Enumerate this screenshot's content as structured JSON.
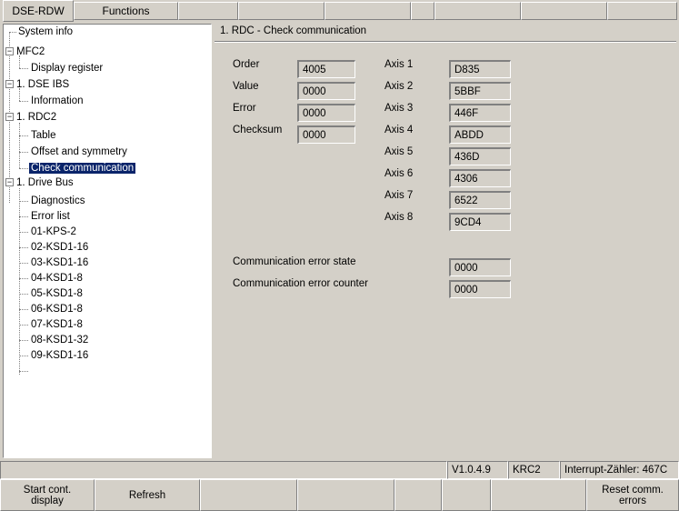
{
  "tabs": [
    {
      "label": "DSE-RDW"
    },
    {
      "label": "Functions"
    },
    {
      "label": ""
    },
    {
      "label": ""
    },
    {
      "label": ""
    },
    {
      "label": ""
    },
    {
      "label": ""
    },
    {
      "label": ""
    },
    {
      "label": ""
    }
  ],
  "tree": {
    "items": [
      {
        "label": "System info"
      },
      {
        "label": "MFC2"
      },
      {
        "label": "Display register"
      },
      {
        "label": "1. DSE IBS"
      },
      {
        "label": "Information"
      },
      {
        "label": "1. RDC2"
      },
      {
        "label": "Table"
      },
      {
        "label": "Offset and symmetry"
      },
      {
        "label": "Check communication"
      },
      {
        "label": "1. Drive Bus"
      },
      {
        "label": "Diagnostics"
      },
      {
        "label": "Error list"
      },
      {
        "label": "01-KPS-2"
      },
      {
        "label": "02-KSD1-16"
      },
      {
        "label": "03-KSD1-16"
      },
      {
        "label": "04-KSD1-8"
      },
      {
        "label": "05-KSD1-8"
      },
      {
        "label": "06-KSD1-8"
      },
      {
        "label": "07-KSD1-8"
      },
      {
        "label": "08-KSD1-32"
      },
      {
        "label": "09-KSD1-16"
      }
    ]
  },
  "main": {
    "title": "1. RDC - Check communication",
    "left_fields": [
      {
        "label": "Order",
        "value": "4005"
      },
      {
        "label": "Value",
        "value": "0000"
      },
      {
        "label": "Error",
        "value": "0000"
      },
      {
        "label": "Checksum",
        "value": "0000"
      }
    ],
    "axes": [
      {
        "label": "Axis 1",
        "value": "D835"
      },
      {
        "label": "Axis 2",
        "value": "5BBF"
      },
      {
        "label": "Axis 3",
        "value": "446F"
      },
      {
        "label": "Axis 4",
        "value": "ABDD"
      },
      {
        "label": "Axis 5",
        "value": "436D"
      },
      {
        "label": "Axis 6",
        "value": "4306"
      },
      {
        "label": "Axis 7",
        "value": "6522"
      },
      {
        "label": "Axis 8",
        "value": "9CD4"
      }
    ],
    "comm_error_state": {
      "label": "Communication error state",
      "value": "0000"
    },
    "comm_error_counter": {
      "label": "Communication error counter",
      "value": "0000"
    }
  },
  "status": {
    "version": "V1.0.4.9",
    "robot": "KRC2",
    "interrupt": "Interrupt-Zähler: 467C"
  },
  "buttons": [
    {
      "label": "Start cont.\ndisplay"
    },
    {
      "label": "Refresh"
    },
    {
      "label": ""
    },
    {
      "label": ""
    },
    {
      "label": ""
    },
    {
      "label": ""
    },
    {
      "label": ""
    },
    {
      "label": "Reset comm.\nerrors"
    }
  ]
}
